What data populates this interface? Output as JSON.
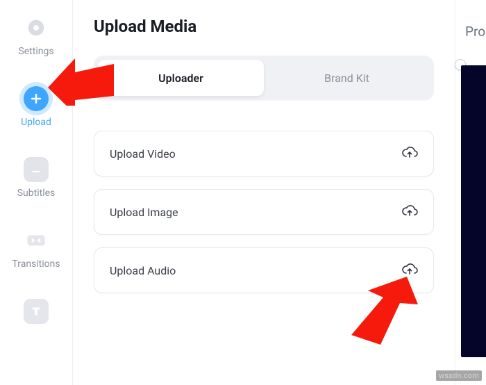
{
  "sidebar": {
    "items": [
      {
        "label": "Settings",
        "icon": "gear-icon"
      },
      {
        "label": "Upload",
        "icon": "plus-icon",
        "active": true
      },
      {
        "label": "Subtitles",
        "icon": "subtitles-icon"
      },
      {
        "label": "Transitions",
        "icon": "transitions-icon"
      },
      {
        "label": "",
        "icon": "text-icon"
      }
    ]
  },
  "page": {
    "title": "Upload Media"
  },
  "tabs": {
    "uploader": "Uploader",
    "brandkit": "Brand Kit"
  },
  "uploads": {
    "video": "Upload Video",
    "image": "Upload Image",
    "audio": "Upload Audio"
  },
  "right": {
    "label": "Pro"
  },
  "watermark": "wsxdn.com"
}
